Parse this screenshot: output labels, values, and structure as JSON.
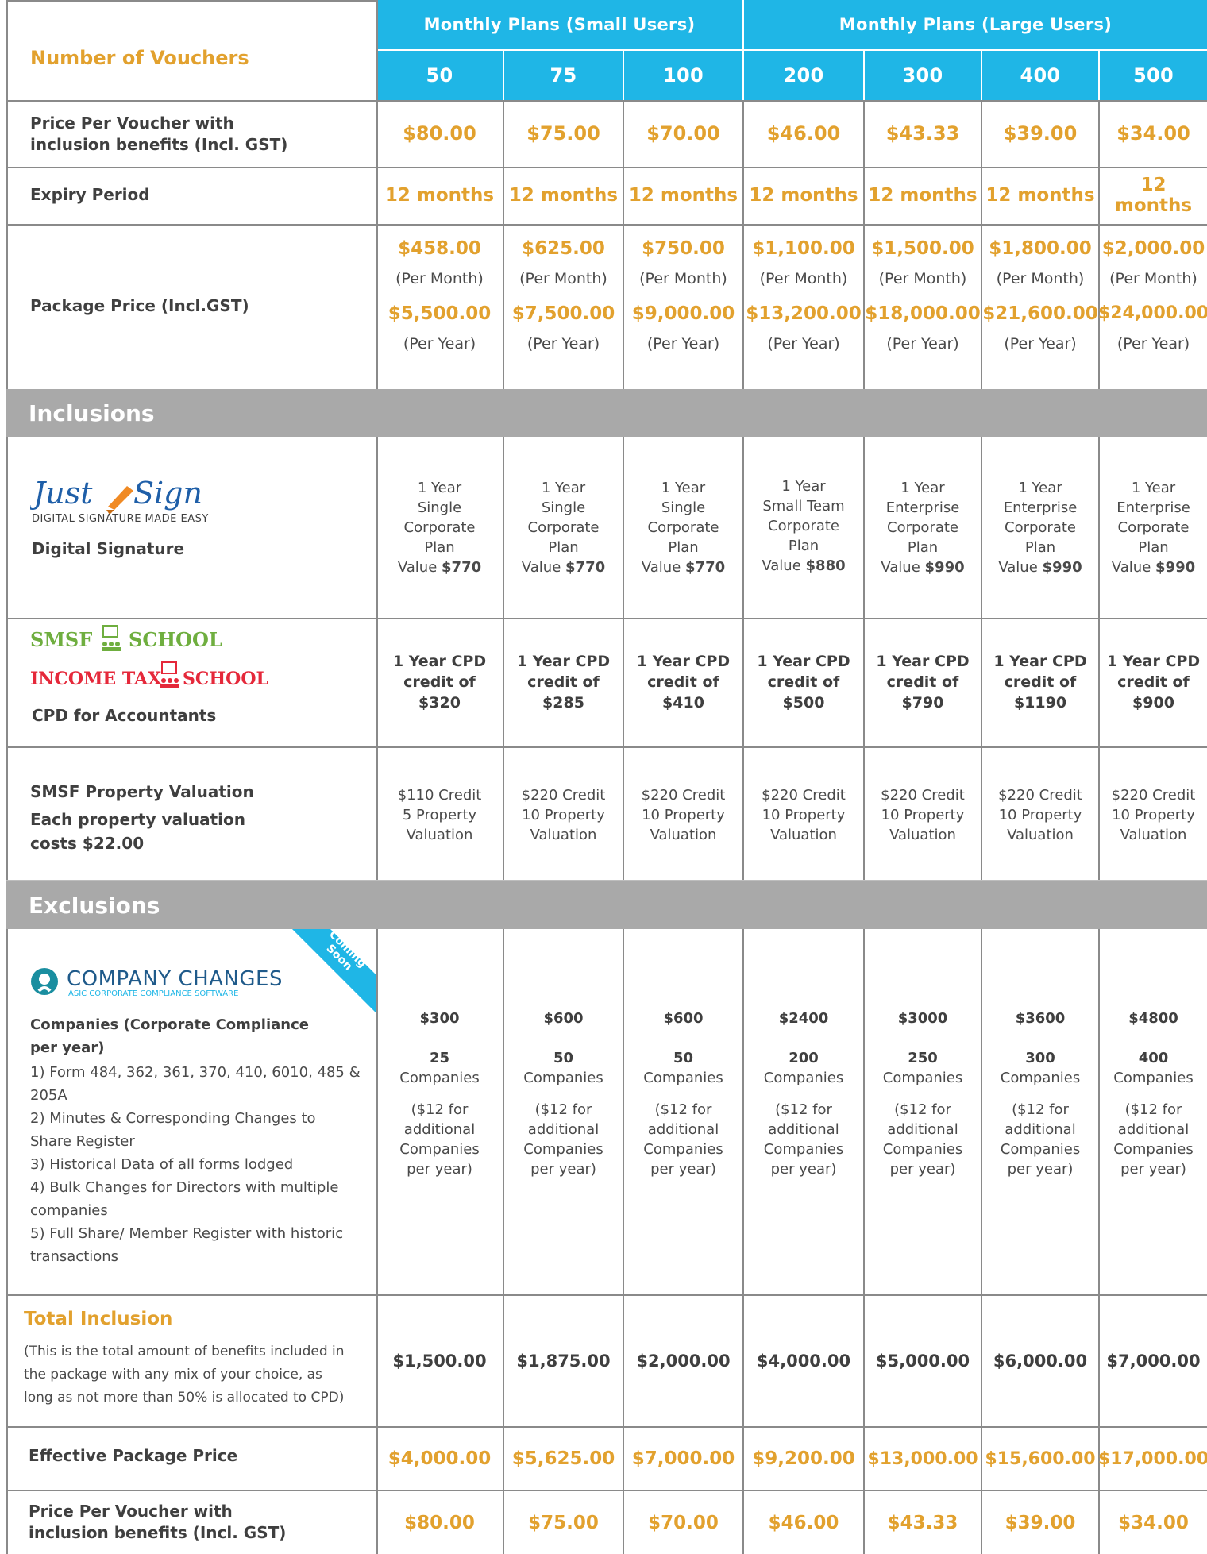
{
  "header": {
    "row_label": "Number of Vouchers",
    "group_small": "Monthly Plans (Small Users)",
    "group_large": "Monthly Plans (Large Users)",
    "vouchers": [
      "50",
      "75",
      "100",
      "200",
      "300",
      "400",
      "500"
    ]
  },
  "price_per_voucher": {
    "label_line1": "Price Per Voucher with",
    "label_line2": "inclusion benefits (Incl. GST)",
    "values": [
      "$80.00",
      "$75.00",
      "$70.00",
      "$46.00",
      "$43.33",
      "$39.00",
      "$34.00"
    ]
  },
  "expiry": {
    "label": "Expiry Period",
    "values": [
      "12 months",
      "12 months",
      "12 months",
      "12 months",
      "12 months",
      "12 months",
      "12 months"
    ]
  },
  "package_price": {
    "label": "Package Price (Incl.GST)",
    "monthly": [
      "$458.00",
      "$625.00",
      "$750.00",
      "$1,100.00",
      "$1,500.00",
      "$1,800.00",
      "$2,000.00"
    ],
    "per_month": "(Per Month)",
    "yearly": [
      "$5,500.00",
      "$7,500.00",
      "$9,000.00",
      "$13,200.00",
      "$18,000.00",
      "$21,600.00",
      "$24,000.00"
    ],
    "per_year": "(Per Year)"
  },
  "inclusions": {
    "title": "Inclusions",
    "digital_signature": {
      "logo_text": "Just Sign",
      "logo_tagline": "DIGITAL SIGNATURE MADE EASY",
      "label": "Digital Signature",
      "plans": [
        {
          "line1": "1 Year",
          "line2": "Single",
          "line3": "Corporate",
          "line4": "Plan",
          "value_prefix": "Value",
          "value": "$770"
        },
        {
          "line1": "1 Year",
          "line2": "Single",
          "line3": "Corporate",
          "line4": "Plan",
          "value_prefix": "Value",
          "value": "$770"
        },
        {
          "line1": "1 Year",
          "line2": "Single",
          "line3": "Corporate",
          "line4": "Plan",
          "value_prefix": "Value",
          "value": "$770"
        },
        {
          "line1": "1 Year",
          "line2": "Small Team",
          "line3": "Corporate",
          "line4": "Plan",
          "value_prefix": "Value",
          "value": "$880"
        },
        {
          "line1": "1 Year",
          "line2": "Enterprise",
          "line3": "Corporate",
          "line4": "Plan",
          "value_prefix": "Value",
          "value": "$990"
        },
        {
          "line1": "1 Year",
          "line2": "Enterprise",
          "line3": "Corporate",
          "line4": "Plan",
          "value_prefix": "Value",
          "value": "$990"
        },
        {
          "line1": "1 Year",
          "line2": "Enterprise",
          "line3": "Corporate",
          "line4": "Plan",
          "value_prefix": "Value",
          "value": "$990"
        }
      ]
    },
    "cpd": {
      "logo1": "SMSF SCHOOL",
      "logo2": "INCOME TAX SCHOOL",
      "label": "CPD for Accountants",
      "line1": "1 Year CPD",
      "line2": "credit of",
      "values": [
        "$320",
        "$285",
        "$410",
        "$500",
        "$790",
        "$1190",
        "$900"
      ]
    },
    "valuation": {
      "label1": "SMSF Property Valuation",
      "label2": "Each property valuation",
      "label3": "costs $22.00",
      "credits": [
        "$110 Credit",
        "$220 Credit",
        "$220 Credit",
        "$220 Credit",
        "$220 Credit",
        "$220 Credit",
        "$220 Credit"
      ],
      "counts": [
        "5 Property",
        "10 Property",
        "10 Property",
        "10 Property",
        "10 Property",
        "10 Property",
        "10 Property"
      ],
      "suffix": "Valuation"
    }
  },
  "exclusions": {
    "title": "Exclusions",
    "ribbon": "Coming Soon",
    "logo_title": "COMPANY CHANGES",
    "logo_sub": "ASIC CORPORATE COMPLIANCE SOFTWARE",
    "heading1": "Companies (Corporate Compliance",
    "heading2": "per year)",
    "items": [
      "1) Form 484, 362, 361, 370, 410, 6010, 485 &",
      "205A",
      "2) Minutes & Corresponding Changes to",
      "Share Register",
      "3) Historical Data of all forms lodged",
      "4) Bulk Changes for Directors with multiple",
      "companies",
      "5) Full Share/ Member Register with historic",
      "transactions"
    ],
    "prices": [
      "$300",
      "$600",
      "$600",
      "$2400",
      "$3000",
      "$3600",
      "$4800"
    ],
    "counts": [
      "25",
      "50",
      "50",
      "200",
      "250",
      "300",
      "400"
    ],
    "companies_word": "Companies",
    "extra1": "($12 for",
    "extra2": "additional",
    "extra3": "Companies",
    "extra4": "per year)"
  },
  "total_inclusion": {
    "label": "Total Inclusion",
    "note1": "(This is the total amount of benefits included in",
    "note2": "the package with any mix of your choice, as",
    "note3": "long as not more than 50% is allocated to CPD)",
    "values": [
      "$1,500.00",
      "$1,875.00",
      "$2,000.00",
      "$4,000.00",
      "$5,000.00",
      "$6,000.00",
      "$7,000.00"
    ]
  },
  "effective_price": {
    "label": "Effective Package Price",
    "values": [
      "$4,000.00",
      "$5,625.00",
      "$7,000.00",
      "$9,200.00",
      "$13,000.00",
      "$15,600.00",
      "$17,000.00"
    ]
  },
  "price_per_voucher_bottom": {
    "label_line1": "Price Per Voucher with",
    "label_line2": "inclusion benefits (Incl. GST)",
    "values": [
      "$80.00",
      "$75.00",
      "$70.00",
      "$46.00",
      "$43.33",
      "$39.00",
      "$34.00"
    ]
  },
  "colors": {
    "header_blue": "#1fb6e6",
    "accent_gold": "#e2a12e",
    "section_grey": "#a9a9a9",
    "income_tax_red": "#e5283a",
    "smsf_green": "#6fae3f",
    "company_changes_teal": "#1a8ea0"
  }
}
